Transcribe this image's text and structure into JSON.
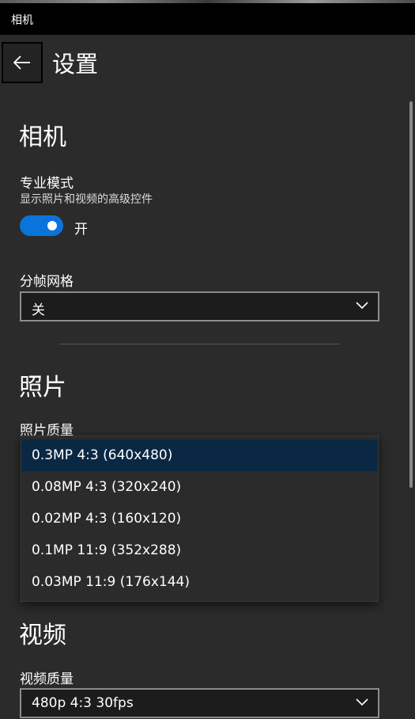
{
  "window": {
    "title": "相机"
  },
  "header": {
    "title": "设置",
    "back_icon": "arrow-left-icon"
  },
  "camera_section": {
    "heading": "相机",
    "pro_mode": {
      "label": "专业模式",
      "description": "显示照片和视频的高级控件",
      "toggle_state": "开",
      "is_on": true,
      "accent": "#0a74da"
    },
    "framing_grid": {
      "label": "分帧网格",
      "value": "关"
    }
  },
  "photo_section": {
    "heading": "照片",
    "quality_label": "照片质量",
    "options": [
      {
        "label": "0.3MP 4:3 (640x480)",
        "selected": true
      },
      {
        "label": "0.08MP 4:3 (320x240)",
        "selected": false
      },
      {
        "label": "0.02MP 4:3 (160x120)",
        "selected": false
      },
      {
        "label": "0.1MP 11:9 (352x288)",
        "selected": false
      },
      {
        "label": "0.03MP 11:9 (176x144)",
        "selected": false
      }
    ]
  },
  "video_section": {
    "heading": "视频",
    "quality_label": "视频质量",
    "value": "480p 4:3 30fps"
  }
}
